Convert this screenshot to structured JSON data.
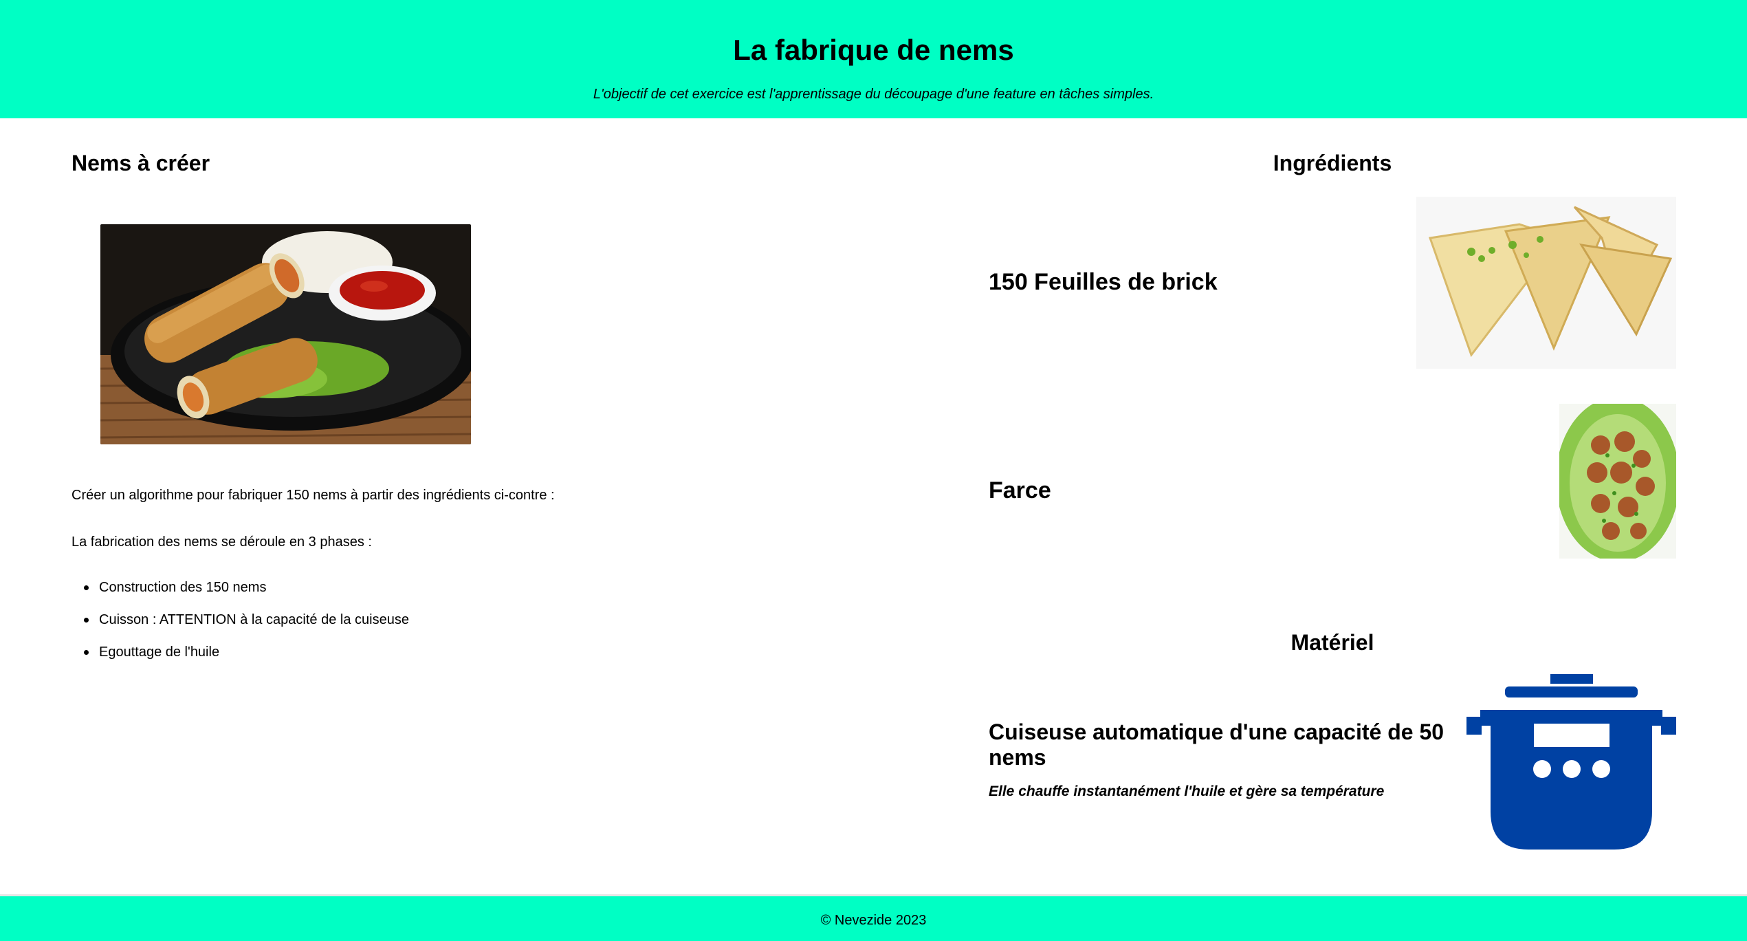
{
  "header": {
    "title": "La fabrique de nems",
    "subtitle": "L'objectif de cet exercice est l'apprentissage du découpage d'une feature en tâches simples."
  },
  "left": {
    "title": "Nems à créer",
    "intro1": "Créer un algorithme pour fabriquer 150 nems à partir des ingrédients ci-contre :",
    "intro2": "La fabrication des nems se déroule en 3 phases :",
    "phases": [
      "Construction des 150 nems",
      "Cuisson : ATTENTION à la capacité de la cuiseuse",
      "Egouttage de l'huile"
    ]
  },
  "ingredients": {
    "title": "Ingrédients",
    "items": [
      {
        "name": "150 Feuilles de brick"
      },
      {
        "name": "Farce"
      }
    ]
  },
  "materiel": {
    "title": "Matériel",
    "name": "Cuiseuse automatique d'une capacité de 50 nems",
    "description": "Elle chauffe instantanément l'huile et gère sa température"
  },
  "footer": {
    "copyright": "© Nevezide 2023"
  },
  "colors": {
    "accent": "#00ffc4",
    "cooker": "#0041a3"
  }
}
